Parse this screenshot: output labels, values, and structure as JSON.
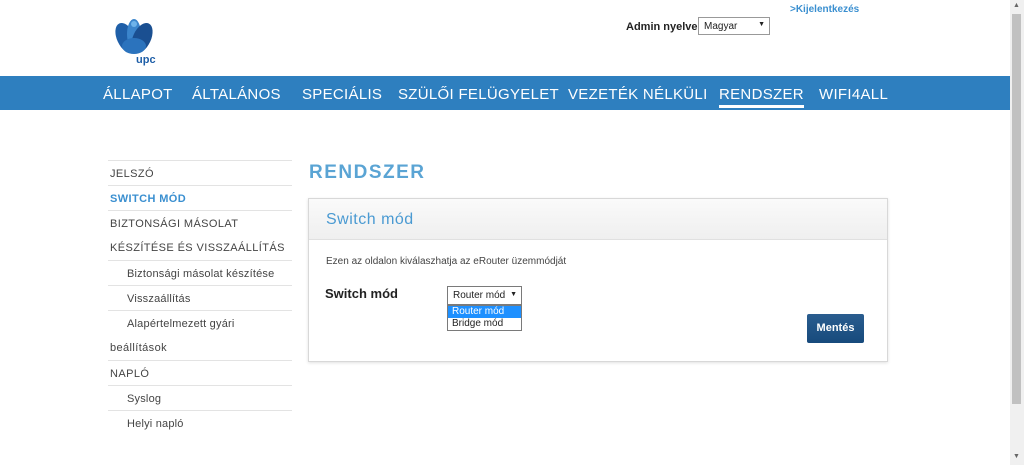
{
  "header": {
    "logo_text": "upc",
    "logout_label": ">Kijelentkezés",
    "language_label": "Admin nyelve",
    "language_value": "Magyar"
  },
  "nav": {
    "items": [
      {
        "label": "ÁLLAPOT"
      },
      {
        "label": "ÁLTALÁNOS"
      },
      {
        "label": "SPECIÁLIS"
      },
      {
        "label": "SZÜLŐI FELÜGYELET"
      },
      {
        "label": "VEZETÉK NÉLKÜLI"
      },
      {
        "label": "RENDSZER"
      },
      {
        "label": "WIFI4ALL"
      }
    ],
    "active": "RENDSZER"
  },
  "sidebar": {
    "items": [
      {
        "label": "JELSZÓ"
      },
      {
        "label": "SWITCH MÓD"
      },
      {
        "label": "BIZTONSÁGI MÁSOLAT"
      },
      {
        "label": "KÉSZÍTÉSE ÉS VISSZAÁLLÍTÁS"
      },
      {
        "label": "Biztonsági másolat készítése"
      },
      {
        "label": "Visszaállítás"
      },
      {
        "label": "Alapértelmezett gyári"
      },
      {
        "label": "beállítások"
      },
      {
        "label": "NAPLÓ"
      },
      {
        "label": "Syslog"
      },
      {
        "label": "Helyi napló"
      }
    ],
    "active": "SWITCH MÓD"
  },
  "main": {
    "page_title": "RENDSZER",
    "panel_title": "Switch mód",
    "description": "Ezen az oldalon kiválaszhatja az eRouter üzemmódját",
    "field_label": "Switch mód",
    "select_value": "Router mód",
    "options": [
      "Router mód",
      "Bridge mód"
    ],
    "save_label": "Mentés"
  },
  "colors": {
    "nav_bg": "#2e7fbf",
    "accent": "#3a8fd0",
    "save_button": "#1f5285"
  }
}
